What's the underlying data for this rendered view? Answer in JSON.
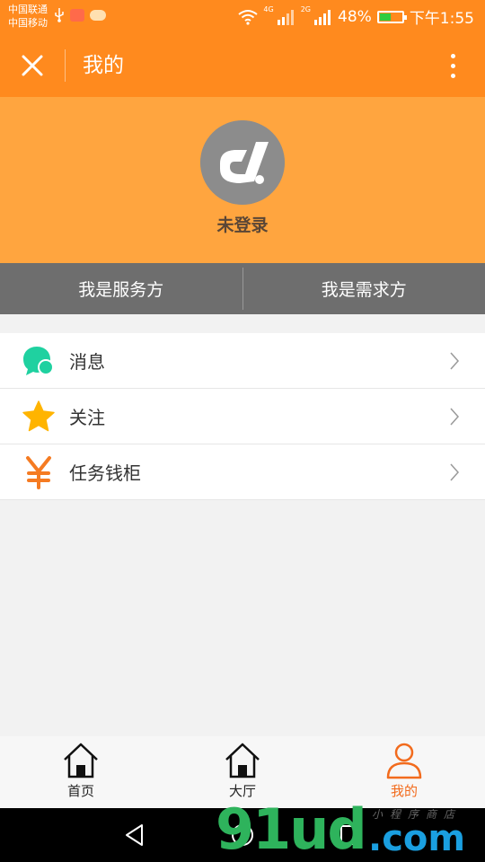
{
  "status_bar": {
    "carrier_1": "中国联通",
    "carrier_2": "中国移动",
    "net_1": "4G",
    "net_2": "2G",
    "battery": "48%",
    "time": "下午1:55"
  },
  "header": {
    "title": "我的",
    "close_icon": "close-icon",
    "more_icon": "more-vertical-icon"
  },
  "profile": {
    "avatar_icon": "app-logo-icon",
    "status": "未登录"
  },
  "roles": {
    "provider": "我是服务方",
    "requester": "我是需求方"
  },
  "menu": [
    {
      "label": "消息",
      "icon": "chat-bubble-icon",
      "color": "#1fd1a0"
    },
    {
      "label": "关注",
      "icon": "star-icon",
      "color": "#ffb400"
    },
    {
      "label": "任务钱柜",
      "icon": "yen-icon",
      "color": "#f57b22"
    }
  ],
  "tabs": [
    {
      "label": "首页",
      "icon": "home-icon"
    },
    {
      "label": "大厅",
      "icon": "hall-icon"
    },
    {
      "label": "我的",
      "icon": "user-icon",
      "active": true
    }
  ],
  "watermark": {
    "main": "91ud",
    "domain": ".com",
    "tagline": "小程序商店"
  },
  "colors": {
    "primary": "#ff8a1e",
    "banner": "#ffa53f",
    "role_bar": "#6e6e6e",
    "active_tab": "#f26b1d"
  }
}
